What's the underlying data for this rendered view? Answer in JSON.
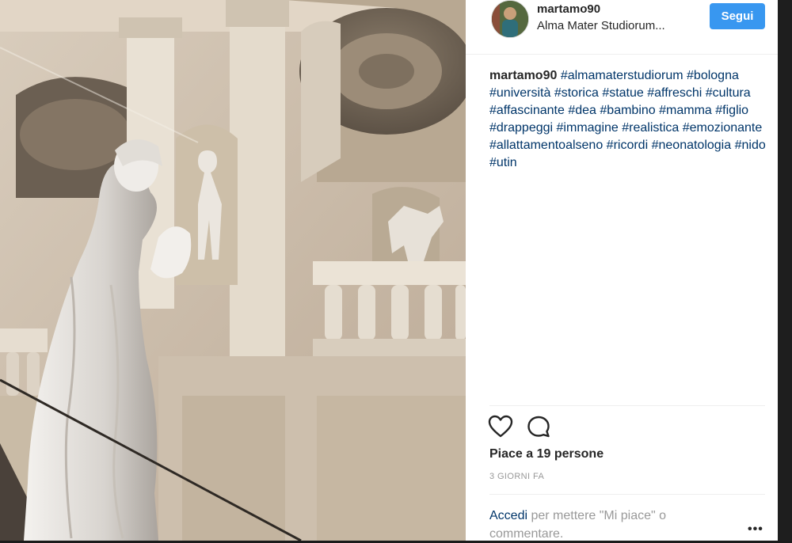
{
  "post": {
    "username": "martamo90",
    "location": "Alma Mater Studiorum...",
    "follow_label": "Segui",
    "caption_user": "martamo90",
    "hashtags": [
      "#almamaterstudiorum",
      "#bologna",
      "#università",
      "#storica",
      "#statue",
      "#affreschi",
      "#cultura",
      "#affascinante",
      "#dea",
      "#bambino",
      "#mamma",
      "#figlio",
      "#drappeggi",
      "#immagine",
      "#realistica",
      "#emozionante",
      "#allattamentoalseno",
      "#ricordi",
      "#neonatologia",
      "#nido",
      "#utin"
    ],
    "likes_text": "Piace a 19 persone",
    "time_ago": "3 GIORNI FA",
    "login_link": "Accedi",
    "login_rest": " per mettere \"Mi piace\" o commentare.",
    "more_label": "•••"
  },
  "icons": {
    "like": "heart-icon",
    "comment": "comment-bubble-icon",
    "more": "more-options-icon"
  },
  "colors": {
    "follow_button": "#3897f0",
    "hashtag": "#003569",
    "muted": "#999999"
  }
}
